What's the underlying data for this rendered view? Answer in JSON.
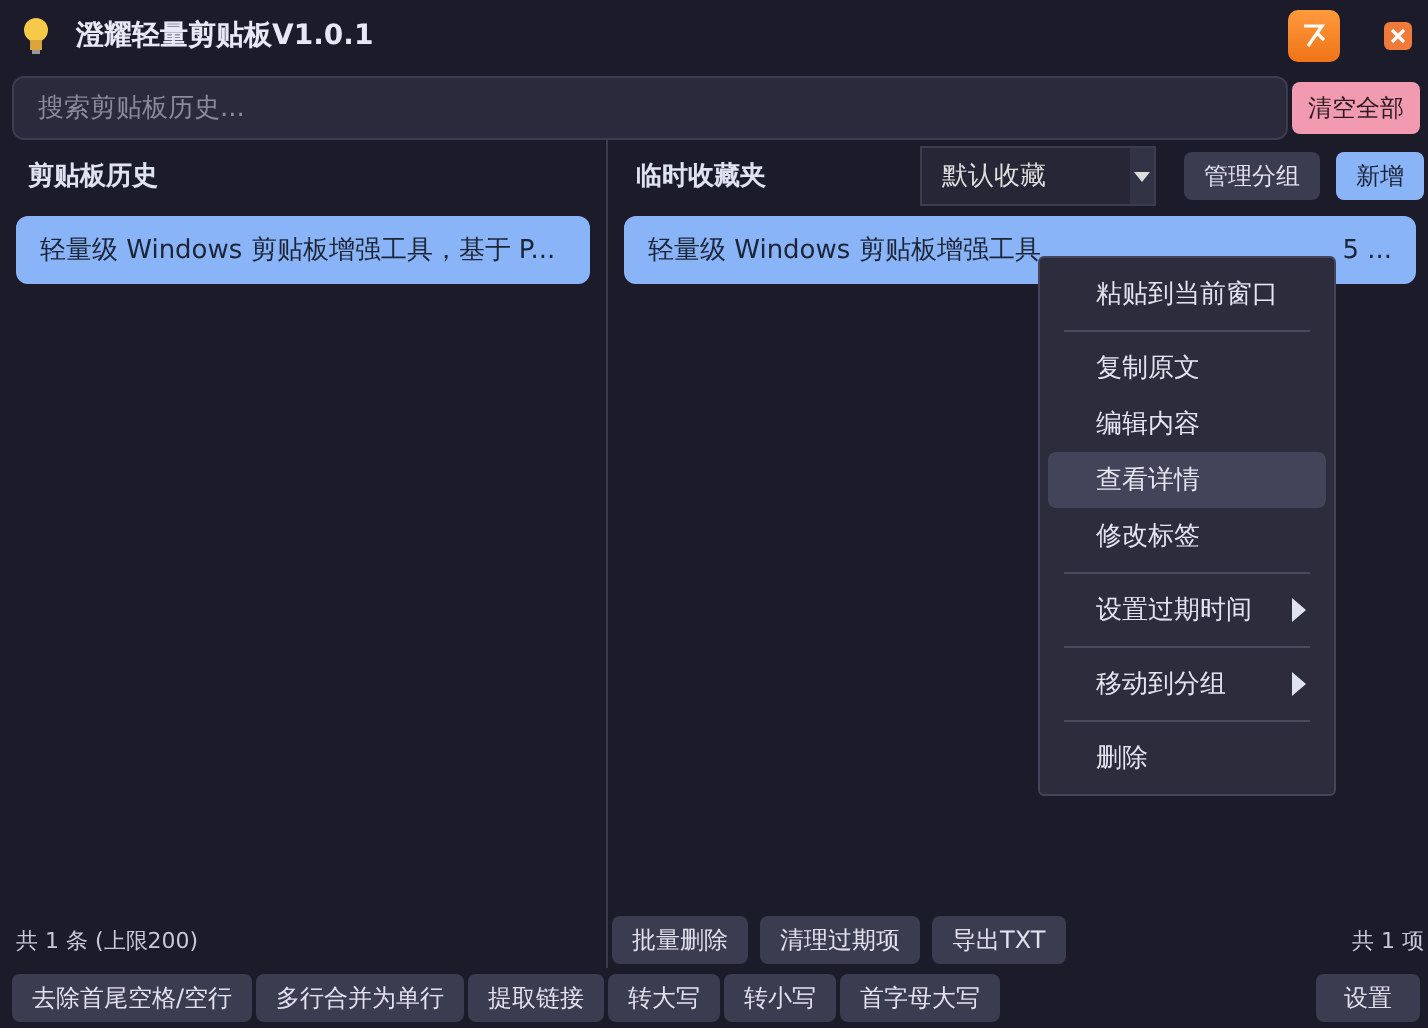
{
  "window": {
    "title": "澄耀轻量剪贴板V1.0.1"
  },
  "search": {
    "placeholder": "搜索剪贴板历史..."
  },
  "clear_all_button": "清空全部",
  "history": {
    "title": "剪贴板历史",
    "items": [
      {
        "text": "轻量级 Windows 剪贴板增强工具，基于 P..."
      }
    ],
    "count": "共 1 条 (上限200)"
  },
  "favorites": {
    "title": "临时收藏夹",
    "group_select": "默认收藏",
    "buttons": [
      "管理分组",
      "新增"
    ],
    "items": [
      {
        "text_start": "轻量级 Windows 剪贴板增强工具",
        "text_end": "5 ..."
      }
    ],
    "actions": [
      "批量删除",
      "清理过期项",
      "导出TXT"
    ],
    "count": "共 1 项"
  },
  "context_menu": [
    {
      "kind": "item",
      "label": "粘贴到当前窗口",
      "selected": false
    },
    {
      "kind": "separator"
    },
    {
      "kind": "item",
      "label": "复制原文",
      "selected": false
    },
    {
      "kind": "item",
      "label": "编辑内容",
      "selected": false
    },
    {
      "kind": "item",
      "label": "查看详情",
      "selected": true
    },
    {
      "kind": "item",
      "label": "修改标签",
      "selected": false
    },
    {
      "kind": "separator"
    },
    {
      "kind": "submenu",
      "label": "设置过期时间",
      "selected": false
    },
    {
      "kind": "separator"
    },
    {
      "kind": "submenu",
      "label": "移动到分组",
      "selected": false
    },
    {
      "kind": "separator"
    },
    {
      "kind": "item",
      "label": "删除",
      "selected": false
    }
  ],
  "tools": [
    "去除首尾空格/空行",
    "多行合并为单行",
    "提取链接",
    "转大写",
    "转小写",
    "首字母大写"
  ],
  "settings_button": "设置"
}
